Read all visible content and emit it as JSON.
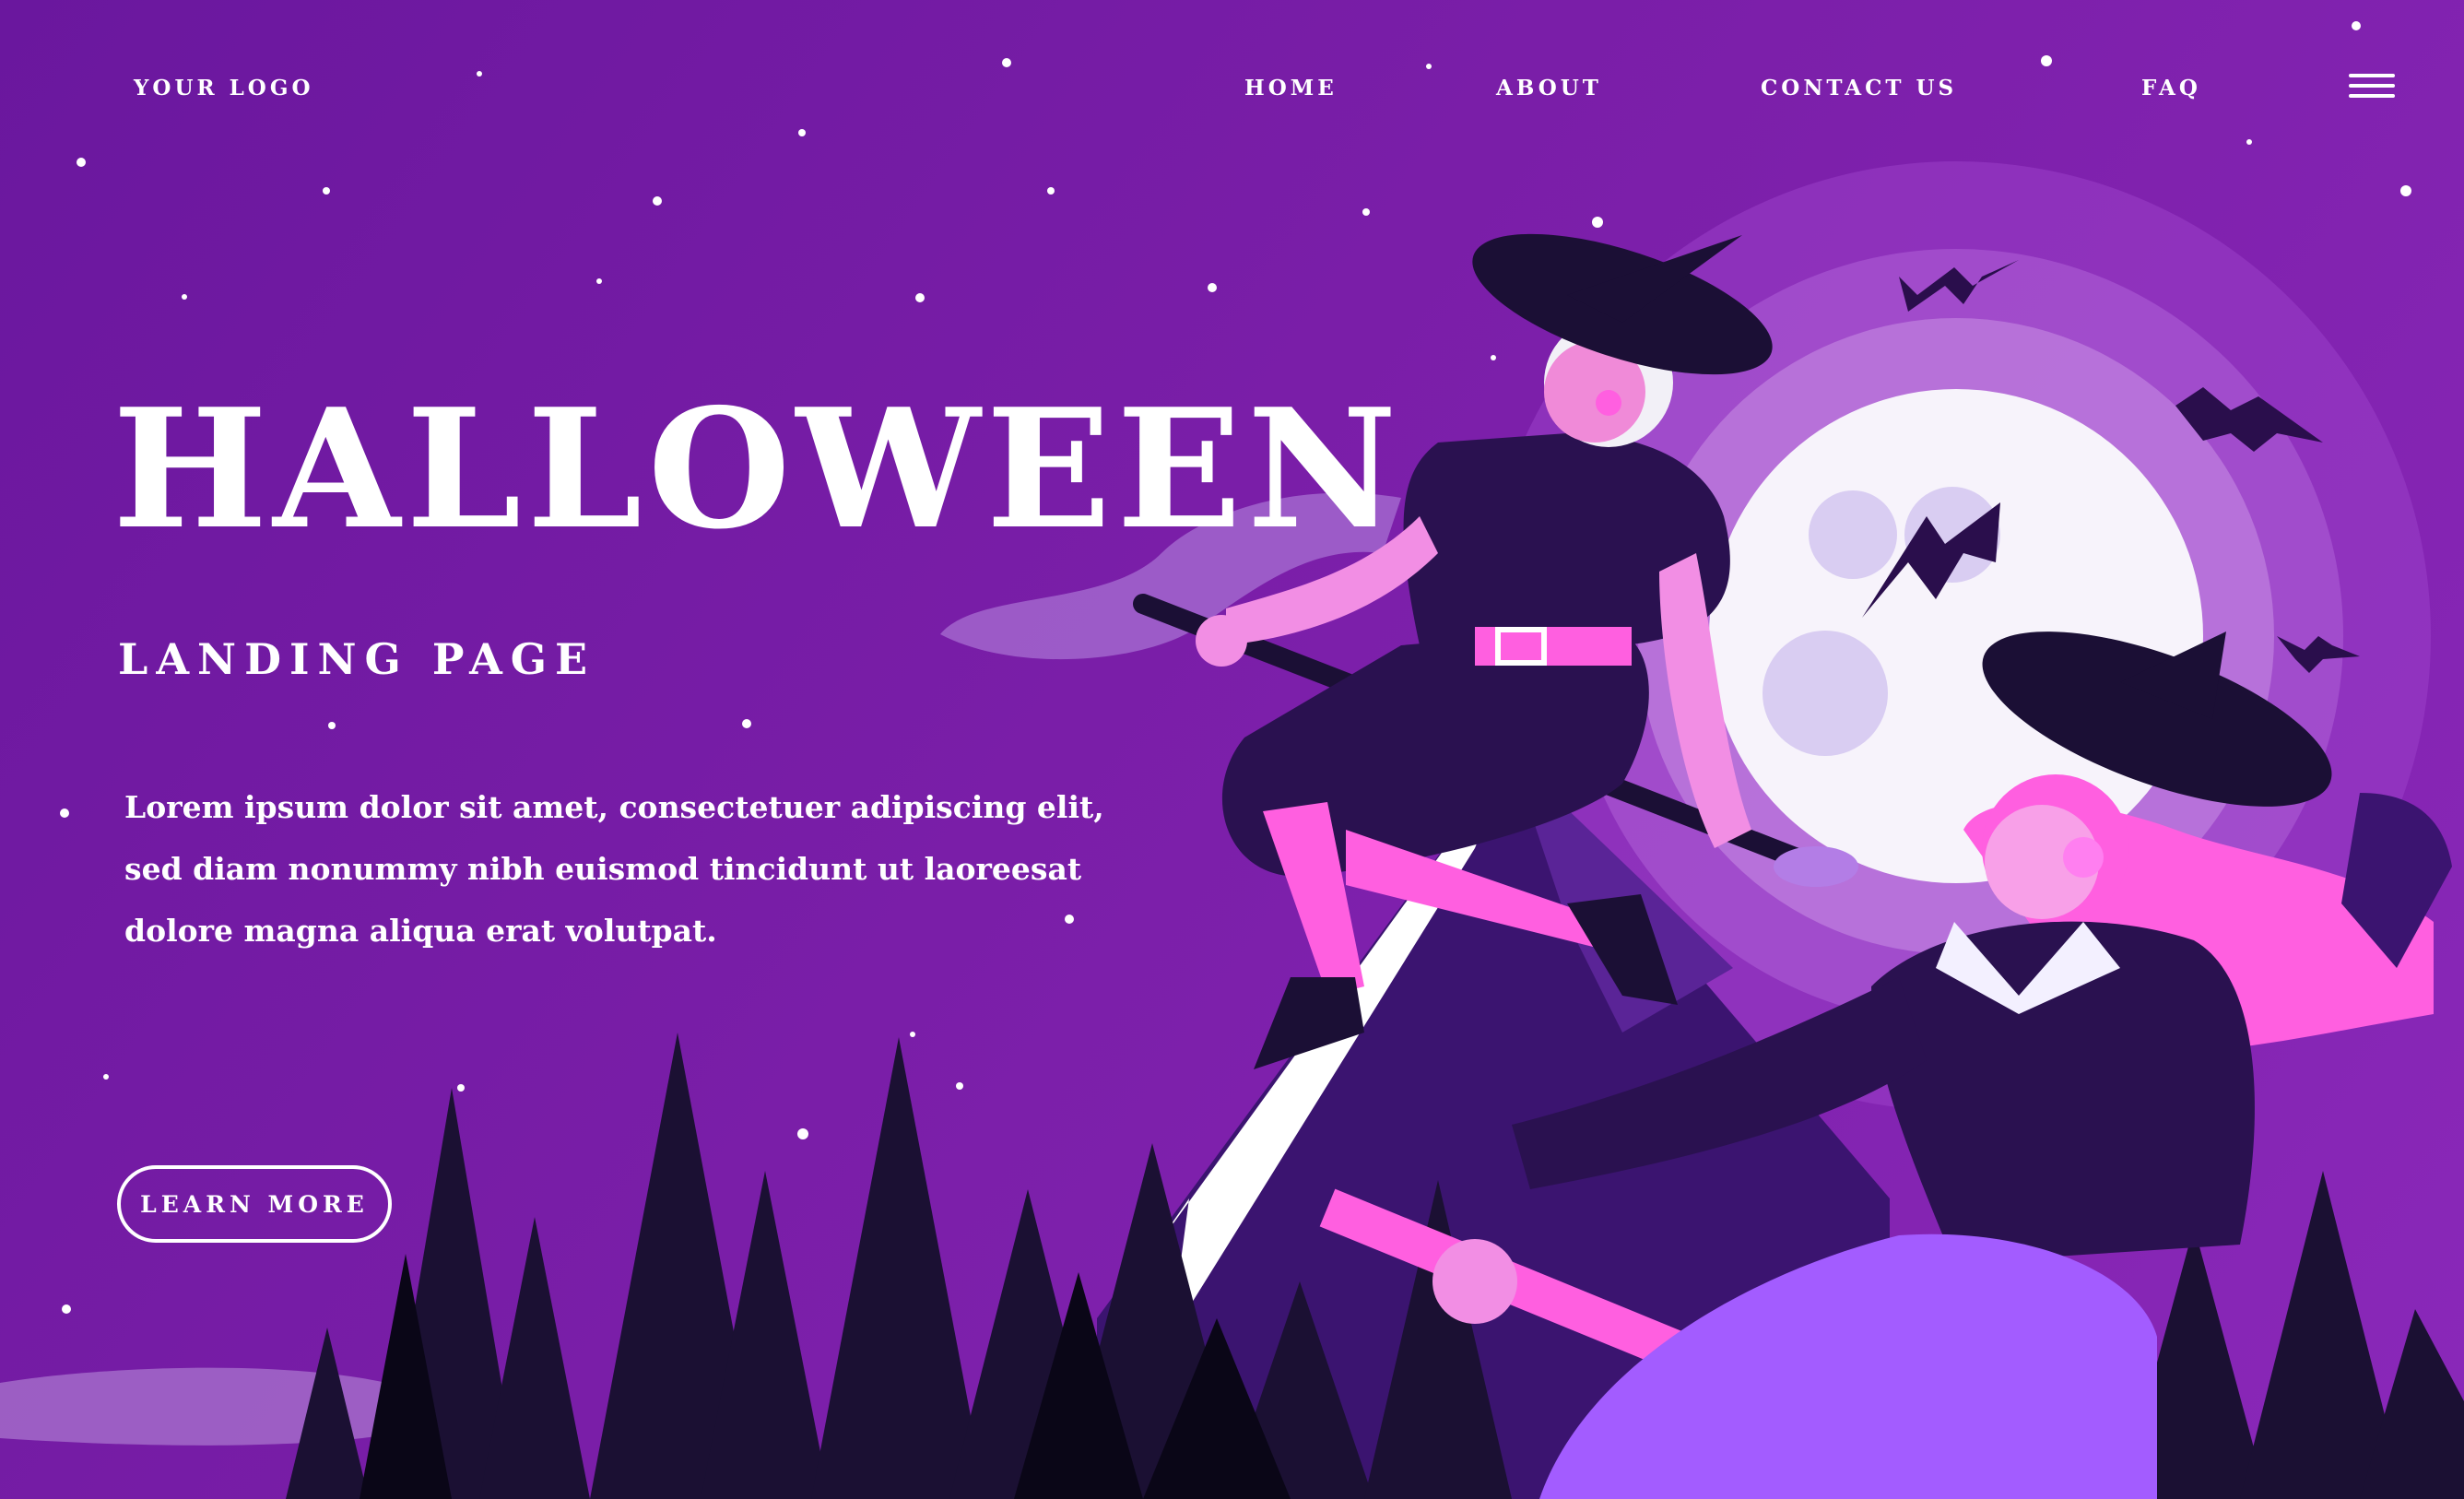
{
  "header": {
    "logo_text": "YOUR LOGO",
    "nav": [
      {
        "label": "HOME"
      },
      {
        "label": "ABOUT"
      },
      {
        "label": "CONTACT US"
      },
      {
        "label": "FAQ"
      }
    ],
    "menu_icon": "hamburger-menu-icon"
  },
  "hero": {
    "title": "HALLOWEEN",
    "subtitle": "LANDING PAGE",
    "description_lines": [
      "Lorem ipsum dolor sit amet, consectetuer adipiscing elit,",
      "sed diam nonummy nibh euismod tincidunt ut laoreesat",
      "dolore magna aliqua erat volutpat."
    ],
    "cta_label": "LEARN MORE"
  },
  "colors": {
    "background": "#7a1ea8",
    "moon": "#f7f3fb",
    "dark_purple": "#1e0b3a",
    "pink": "#ff4fd8",
    "lilac": "#a35cff"
  }
}
